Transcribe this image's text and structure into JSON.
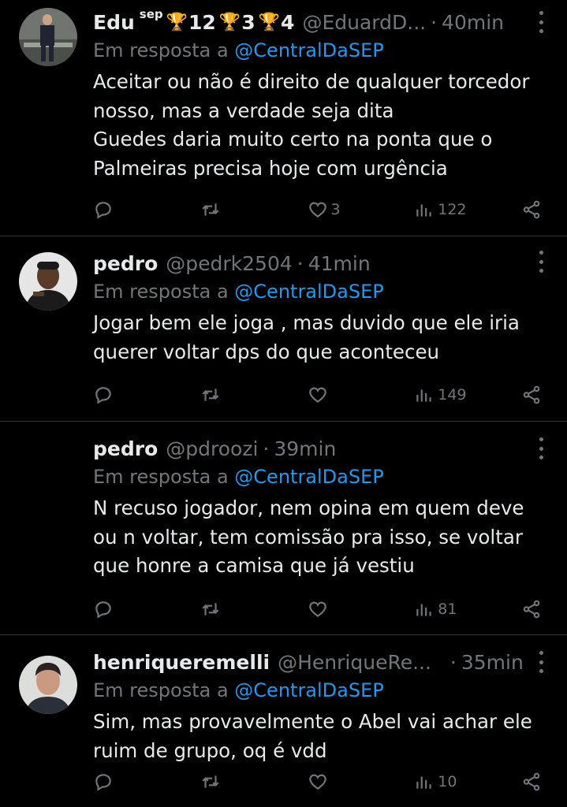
{
  "reply_prefix": "Em resposta a",
  "tweets": [
    {
      "name": "Edu",
      "name_sup": "sep",
      "badges": [
        "12",
        "3",
        "4"
      ],
      "handle": "@EduardD...",
      "separator": "·",
      "time": "40min",
      "reply_to": "@CentralDaSEP",
      "body": [
        "Aceitar ou não é direito de qualquer torcedor",
        "nosso, mas a verdade seja dita",
        "Guedes daria muito certo na ponta que o",
        "Palmeiras precisa hoje com urgência"
      ],
      "replies": "",
      "retweets": "",
      "likes": "3",
      "views": "122",
      "avatar_colors": [
        "#3a3d3a",
        "#8a8f87"
      ]
    },
    {
      "name": "pedro",
      "handle": "@pedrk2504",
      "separator": "·",
      "time": "41min",
      "reply_to": "@CentralDaSEP",
      "body": [
        "Jogar bem ele joga , mas duvido que ele iria",
        "querer voltar dps do que aconteceu"
      ],
      "replies": "",
      "retweets": "",
      "likes": "",
      "views": "149",
      "avatar_colors": [
        "#2b2b2b",
        "#7a5a44"
      ]
    },
    {
      "name": "pedro",
      "handle": "@pdroozi",
      "separator": "·",
      "time": "39min",
      "reply_to": "@CentralDaSEP",
      "body": [
        "N recuso jogador, nem opina em quem deve",
        "ou n voltar, tem comissão pra isso, se voltar",
        "que honre a camisa que já vestiu"
      ],
      "replies": "",
      "retweets": "",
      "likes": "",
      "views": "81"
    },
    {
      "name": "henriqueremelli",
      "handle": "@HenriqueRe...",
      "separator": "·",
      "time": "35min",
      "reply_to": "@CentralDaSEP",
      "body": [
        "Sim, mas provavelmente o Abel vai achar ele",
        "ruim de grupo, oq é vdd"
      ],
      "replies": "",
      "retweets": "",
      "likes": "",
      "views": "10",
      "avatar_colors": [
        "#d9dbd8",
        "#c99a80"
      ]
    }
  ]
}
